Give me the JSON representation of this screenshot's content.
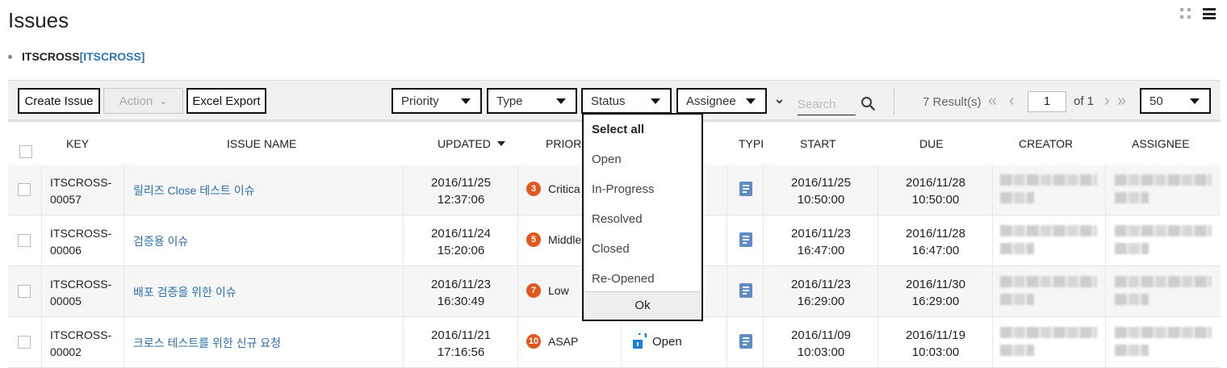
{
  "page": {
    "title": "Issues"
  },
  "project": {
    "name": "ITSCROSS",
    "key": "[ITSCROSS]"
  },
  "toolbar": {
    "create_issue": "Create Issue",
    "action": "Action",
    "excel_export": "Excel Export",
    "filters": {
      "priority": "Priority",
      "type": "Type",
      "status": "Status",
      "assignee": "Assignee"
    },
    "search_placeholder": "Search",
    "result_count": "7 Result(s)",
    "page_current": "1",
    "page_of": "of 1",
    "page_size": "50"
  },
  "status_dropdown": {
    "select_all": "Select all",
    "options": [
      "Open",
      "In-Progress",
      "Resolved",
      "Closed",
      "Re-Opened"
    ],
    "ok": "Ok"
  },
  "table": {
    "headers": {
      "key": "KEY",
      "issue_name": "ISSUE NAME",
      "updated": "UPDATED",
      "priority": "PRIOR",
      "type": "TYPI",
      "start": "START",
      "due": "DUE",
      "creator": "CREATOR",
      "assignee": "ASSIGNEE"
    },
    "rows": [
      {
        "key_line1": "ITSCROSS-",
        "key_line2": "00057",
        "name": "릴리즈 Close 테스트 이슈",
        "updated_date": "2016/11/25",
        "updated_time": "12:37:06",
        "priority_badge": "3",
        "priority": "Critica",
        "status": "",
        "start_date": "2016/11/25",
        "start_time": "10:50:00",
        "due_date": "2016/11/28",
        "due_time": "10:50:00"
      },
      {
        "key_line1": "ITSCROSS-",
        "key_line2": "00006",
        "name": "검증용 이슈",
        "updated_date": "2016/11/24",
        "updated_time": "15:20:06",
        "priority_badge": "5",
        "priority": "Middle",
        "status": "",
        "start_date": "2016/11/23",
        "start_time": "16:47:00",
        "due_date": "2016/11/28",
        "due_time": "16:47:00"
      },
      {
        "key_line1": "ITSCROSS-",
        "key_line2": "00005",
        "name": "배포 검증을 위한 이슈",
        "updated_date": "2016/11/23",
        "updated_time": "16:30:49",
        "priority_badge": "7",
        "priority": "Low",
        "status": "",
        "start_date": "2016/11/23",
        "start_time": "16:29:00",
        "due_date": "2016/11/30",
        "due_time": "16:29:00"
      },
      {
        "key_line1": "ITSCROSS-",
        "key_line2": "00002",
        "name": "크로스 테스트를 위한 신규 요청",
        "updated_date": "2016/11/21",
        "updated_time": "17:16:56",
        "priority_badge": "10",
        "priority": "ASAP",
        "status": "Open",
        "start_date": "2016/11/09",
        "start_time": "10:03:00",
        "due_date": "2016/11/19",
        "due_time": "10:03:00"
      }
    ]
  },
  "colors": {
    "link": "#2a6fae",
    "priority_badge": "#e2571e",
    "type_icon": "#5d8dc4",
    "toolbar_bg": "#f1f1f1"
  },
  "icons": [
    "grid-icon",
    "menu-icon",
    "search-icon",
    "type-task-icon",
    "unlock-icon",
    "caret-down-icon"
  ]
}
